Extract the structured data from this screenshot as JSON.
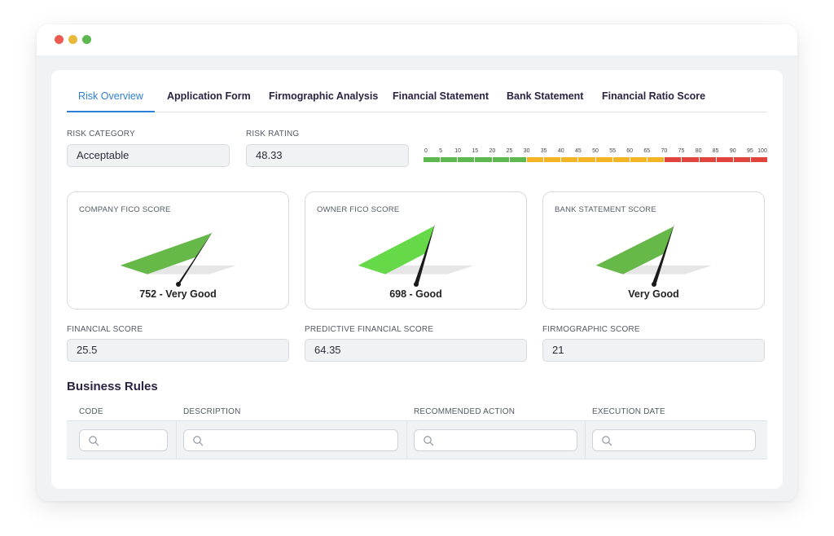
{
  "colors": {
    "window_dots": [
      "#ec5b52",
      "#e8b93a",
      "#5cb84f"
    ],
    "accent": "#2f7fd6",
    "scale": {
      "green": "#5cb84f",
      "yellow": "#f4b324",
      "red": "#e0443c"
    },
    "gauge_bg": "#e6e6e6",
    "gauge_fills": [
      "#66b848",
      "#66d948",
      "#66b848"
    ],
    "needle": "#1a1a1a"
  },
  "tabs": [
    {
      "label": "Risk Overview",
      "active": true
    },
    {
      "label": "Application Form"
    },
    {
      "label": "Firmographic Analysis"
    },
    {
      "label": "Financial Statement"
    },
    {
      "label": "Bank Statement"
    },
    {
      "label": "Financial Ratio Score"
    }
  ],
  "risk": {
    "category_label": "RISK CATEGORY",
    "category_value": "Acceptable",
    "rating_label": "RISK RATING",
    "rating_value": "48.33"
  },
  "rating_scale": {
    "ticks": [
      "0",
      "5",
      "10",
      "15",
      "20",
      "25",
      "30",
      "35",
      "40",
      "45",
      "50",
      "55",
      "60",
      "65",
      "70",
      "75",
      "80",
      "85",
      "90",
      "95",
      "100"
    ],
    "segments": [
      "green",
      "green",
      "green",
      "green",
      "green",
      "green",
      "yellow",
      "yellow",
      "yellow",
      "yellow",
      "yellow",
      "yellow",
      "yellow",
      "yellow",
      "red",
      "red",
      "red",
      "red",
      "red",
      "red"
    ]
  },
  "gauges": [
    {
      "label": "COMPANY FICO SCORE",
      "value_text": "752 - Very Good",
      "level": 0.73
    },
    {
      "label": "OWNER FICO SCORE",
      "value_text": "698 - Good",
      "level": 0.62
    },
    {
      "label": "BANK STATEMENT SCORE",
      "value_text": "Very Good",
      "level": 0.63
    }
  ],
  "scores": [
    {
      "label": "FINANCIAL SCORE",
      "value": "25.5"
    },
    {
      "label": "PREDICTIVE FINANCIAL SCORE",
      "value": "64.35"
    },
    {
      "label": "FIRMOGRAPHIC SCORE",
      "value": "21"
    }
  ],
  "business_rules": {
    "title": "Business Rules",
    "columns": [
      "CODE",
      "DESCRIPTION",
      "RECOMMENDED ACTION",
      "EXECUTION DATE"
    ]
  }
}
